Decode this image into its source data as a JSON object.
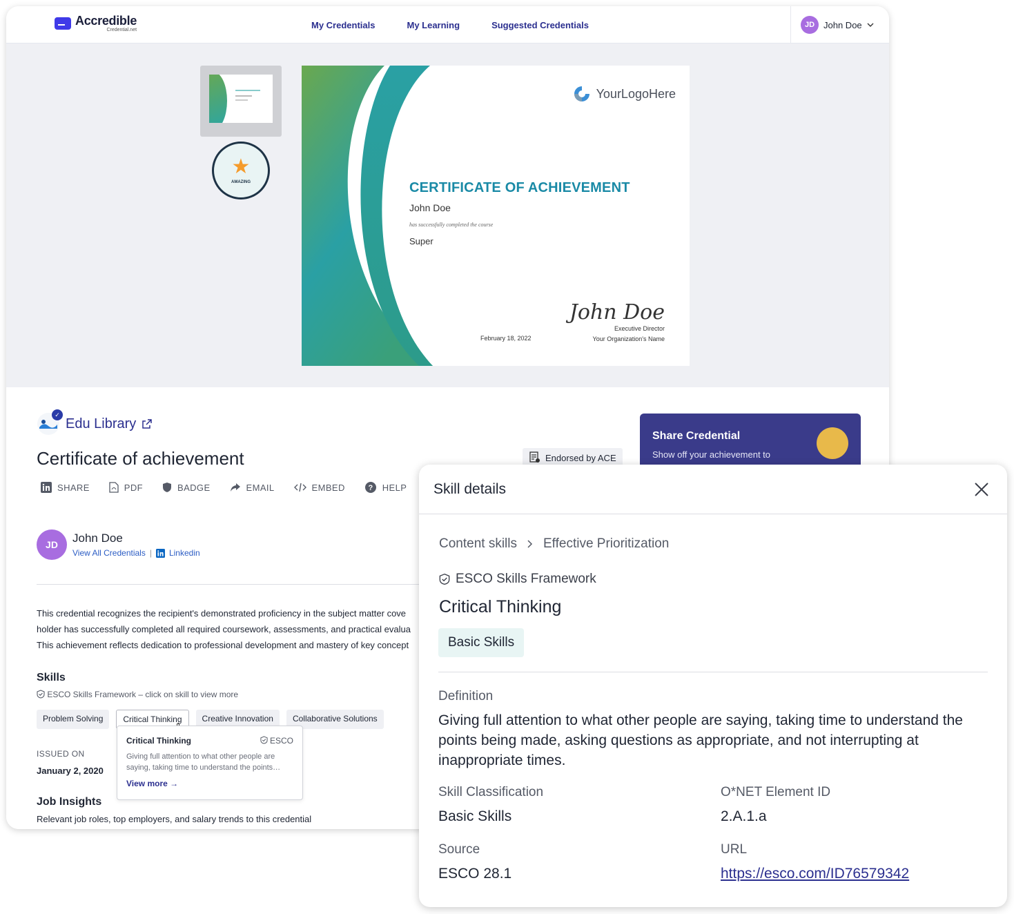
{
  "brand": {
    "name": "Accredible",
    "sub": "Credential.net"
  },
  "nav": {
    "links": [
      "My Credentials",
      "My Learning",
      "Suggested Credentials"
    ]
  },
  "user": {
    "initials": "JD",
    "name": "John Doe"
  },
  "certificate": {
    "logo_text": "YourLogoHere",
    "title": "CERTIFICATE OF ACHIEVEMENT",
    "recipient": "John Doe",
    "completed_text": "has successfully completed the course",
    "course": "Super",
    "signature": "John Doe",
    "signer_title": "Executive Director",
    "org_name": "Your Organization's Name",
    "date": "February 18, 2022"
  },
  "badge": {
    "label": "AMAZING"
  },
  "issuer": {
    "name": "Edu Library"
  },
  "page_title": "Certificate of achievement",
  "endorsement": "Endorsed by ACE",
  "share_card": {
    "title": "Share Credential",
    "subtitle": "Show off your achievement to"
  },
  "actions": [
    "SHARE",
    "PDF",
    "BADGE",
    "EMAIL",
    "EMBED",
    "HELP"
  ],
  "owner": {
    "initials": "JD",
    "name": "John Doe",
    "view_all": "View All Credentials",
    "linkedin": "Linkedin"
  },
  "description": [
    "This credential recognizes the recipient's demonstrated proficiency in the subject matter cove",
    "holder has successfully completed all required coursework, assessments, and practical evalua",
    "This achievement reflects dedication to professional development and mastery of key concept"
  ],
  "skills": {
    "heading": "Skills",
    "subheading": "ESCO Skills Framework – click on skill to view more",
    "chips": [
      "Problem Solving",
      "Critical Thinking",
      "Creative Innovation",
      "Collaborative Solutions"
    ]
  },
  "issued": {
    "label": "ISSUED ON",
    "date": "January 2, 2020"
  },
  "popover": {
    "title": "Critical Thinking",
    "source": "ESCO",
    "text": "Giving full attention to what other people are saying, taking time to understand the points…",
    "more": "View more"
  },
  "job_insights": {
    "heading": "Job Insights",
    "subheading": "Relevant job roles, top employers, and salary trends to this credential"
  },
  "panel": {
    "title": "Skill details",
    "breadcrumb": [
      "Content skills",
      "Effective Prioritization"
    ],
    "framework": "ESCO Skills Framework",
    "skill_name": "Critical Thinking",
    "tag": "Basic Skills",
    "definition_label": "Definition",
    "definition": "Giving full attention to what other people are saying, taking time to understand the points being made, asking questions as appropriate, and not interrupting at inappropriate times.",
    "classification_label": "Skill Classification",
    "classification": "Basic Skills",
    "onet_label": "O*NET Element ID",
    "onet": "2.A.1.a",
    "source_label": "Source",
    "source": "ESCO 28.1",
    "url_label": "URL",
    "url": "https://esco.com/ID76579342"
  },
  "colors": {
    "brand": "#3f3ae8",
    "nav_link": "#2b2f8f",
    "cert_title": "#1a8aa6",
    "avatar": "#a86de0",
    "share_card": "#3a3b8a",
    "tag_bg": "#e8f5f4"
  }
}
